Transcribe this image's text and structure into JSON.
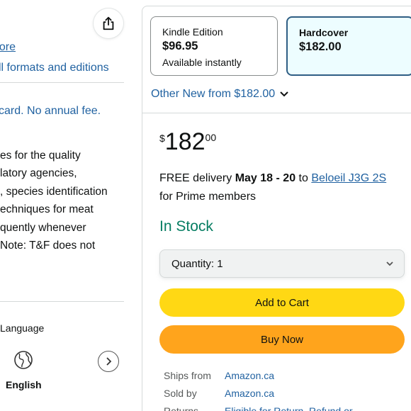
{
  "left": {
    "read_more": "nore",
    "formats_link": "ll formats and editions",
    "card_line": "card. No annual fee.",
    "description_lines": [
      "es for the quality",
      "latory agencies,",
      ", species identification",
      "echniques for meat",
      "quently whenever",
      "Note: T&F does not"
    ],
    "language_label": "Language",
    "language_value": "English",
    "icons": {
      "share": "share-icon",
      "globe": "globe-icon",
      "next": "chevron-right-icon"
    }
  },
  "buybox": {
    "formats": [
      {
        "name": "Kindle Edition",
        "price": "$96.95",
        "note": "Available instantly",
        "selected": false
      },
      {
        "name": "Hardcover",
        "price": "$182.00",
        "note": "",
        "selected": true
      }
    ],
    "other_new": "Other New from $182.00",
    "price": {
      "symbol": "$",
      "whole": "182",
      "fraction": "00"
    },
    "delivery": {
      "prefix": "FREE delivery ",
      "dates": "May 18 - 20",
      "mid": " to ",
      "location": "Beloeil J3G 2S",
      "suffix": " for Prime members"
    },
    "stock": "In Stock",
    "quantity_label": "Quantity:",
    "quantity_value": "1",
    "add_to_cart": "Add to Cart",
    "buy_now": "Buy Now",
    "details": [
      {
        "key": "Ships from",
        "value": "Amazon.ca"
      },
      {
        "key": "Sold by",
        "value": "Amazon.ca"
      },
      {
        "key": "Returns",
        "value": "Eligible for Return, Refund or"
      }
    ],
    "colors": {
      "link": "#2162a1",
      "stock": "#067d62",
      "cart": "#ffd814",
      "buy": "#ffa41c",
      "selected_border": "#2f5e84"
    }
  }
}
